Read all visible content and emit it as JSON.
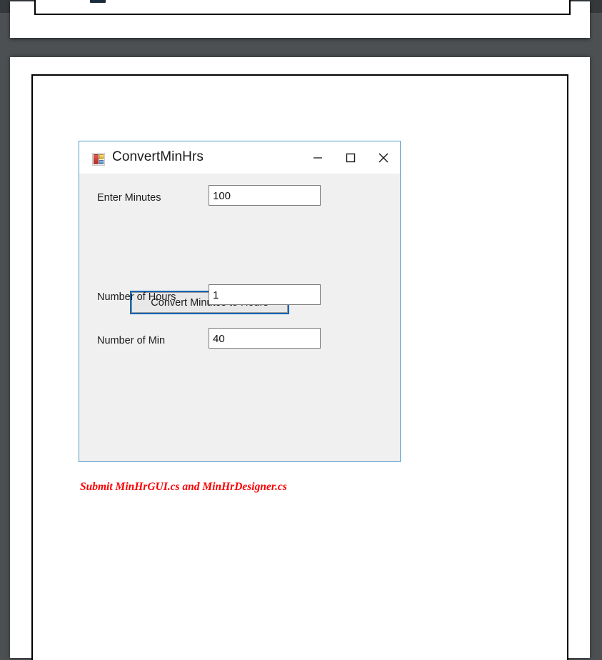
{
  "window": {
    "title": "ConvertMinHrs",
    "icon_name": "winforms-app-icon",
    "controls": {
      "minimize_label": "—",
      "maximize_label": "□",
      "close_label": "✕"
    },
    "colors": {
      "form_border": "#4e9acb",
      "form_background": "#f0f0f0",
      "titlebar_background": "#ffffff",
      "button_focus_border": "#0065b8",
      "textbox_border": "#7a7a7a",
      "note_color": "#fa0000",
      "page_background": "#ffffff",
      "viewer_backdrop": "#4c5053"
    }
  },
  "form": {
    "fields": [
      {
        "label": "Enter Minutes",
        "value": "100"
      },
      {
        "label": "Number of Hours",
        "value": "1"
      },
      {
        "label": "Number of Min",
        "value": "40"
      }
    ],
    "button": {
      "label": "Convert Minutes to Hours"
    }
  },
  "document": {
    "note": "Submit MinHrGUI.cs and MinHrDesigner.cs"
  }
}
